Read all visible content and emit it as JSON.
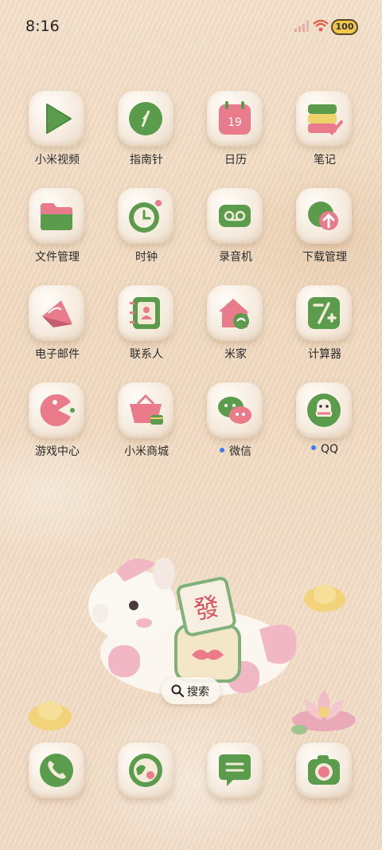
{
  "status_bar": {
    "time": "8:16",
    "battery": "100"
  },
  "apps": [
    {
      "label": "小米视频",
      "icon": "play-icon",
      "dot": false
    },
    {
      "label": "指南针",
      "icon": "compass-icon",
      "dot": false
    },
    {
      "label": "日历",
      "icon": "calendar-icon",
      "calendar_day": "19",
      "dot": false
    },
    {
      "label": "笔记",
      "icon": "notes-icon",
      "dot": false
    },
    {
      "label": "文件管理",
      "icon": "folder-icon",
      "dot": false
    },
    {
      "label": "时钟",
      "icon": "clock-icon",
      "dot": false
    },
    {
      "label": "录音机",
      "icon": "recorder-icon",
      "dot": false
    },
    {
      "label": "下载管理",
      "icon": "download-icon",
      "dot": false
    },
    {
      "label": "电子邮件",
      "icon": "mail-icon",
      "dot": false
    },
    {
      "label": "联系人",
      "icon": "contacts-icon",
      "dot": false
    },
    {
      "label": "米家",
      "icon": "home-icon",
      "dot": false
    },
    {
      "label": "计算器",
      "icon": "calculator-icon",
      "dot": false
    },
    {
      "label": "游戏中心",
      "icon": "game-icon",
      "dot": false
    },
    {
      "label": "小米商城",
      "icon": "shop-icon",
      "dot": false
    },
    {
      "label": "微信",
      "icon": "wechat-icon",
      "dot": true
    },
    {
      "label": "QQ",
      "icon": "qq-icon",
      "dot": true
    }
  ],
  "search": {
    "label": "搜索"
  },
  "widget": {
    "tile_text": "發"
  },
  "dock": [
    {
      "icon": "phone-icon"
    },
    {
      "icon": "browser-icon"
    },
    {
      "icon": "messages-icon"
    },
    {
      "icon": "camera-icon"
    }
  ],
  "colors": {
    "green": "#5e9e4f",
    "pink": "#e4798a",
    "tile": "#f7ede0"
  }
}
